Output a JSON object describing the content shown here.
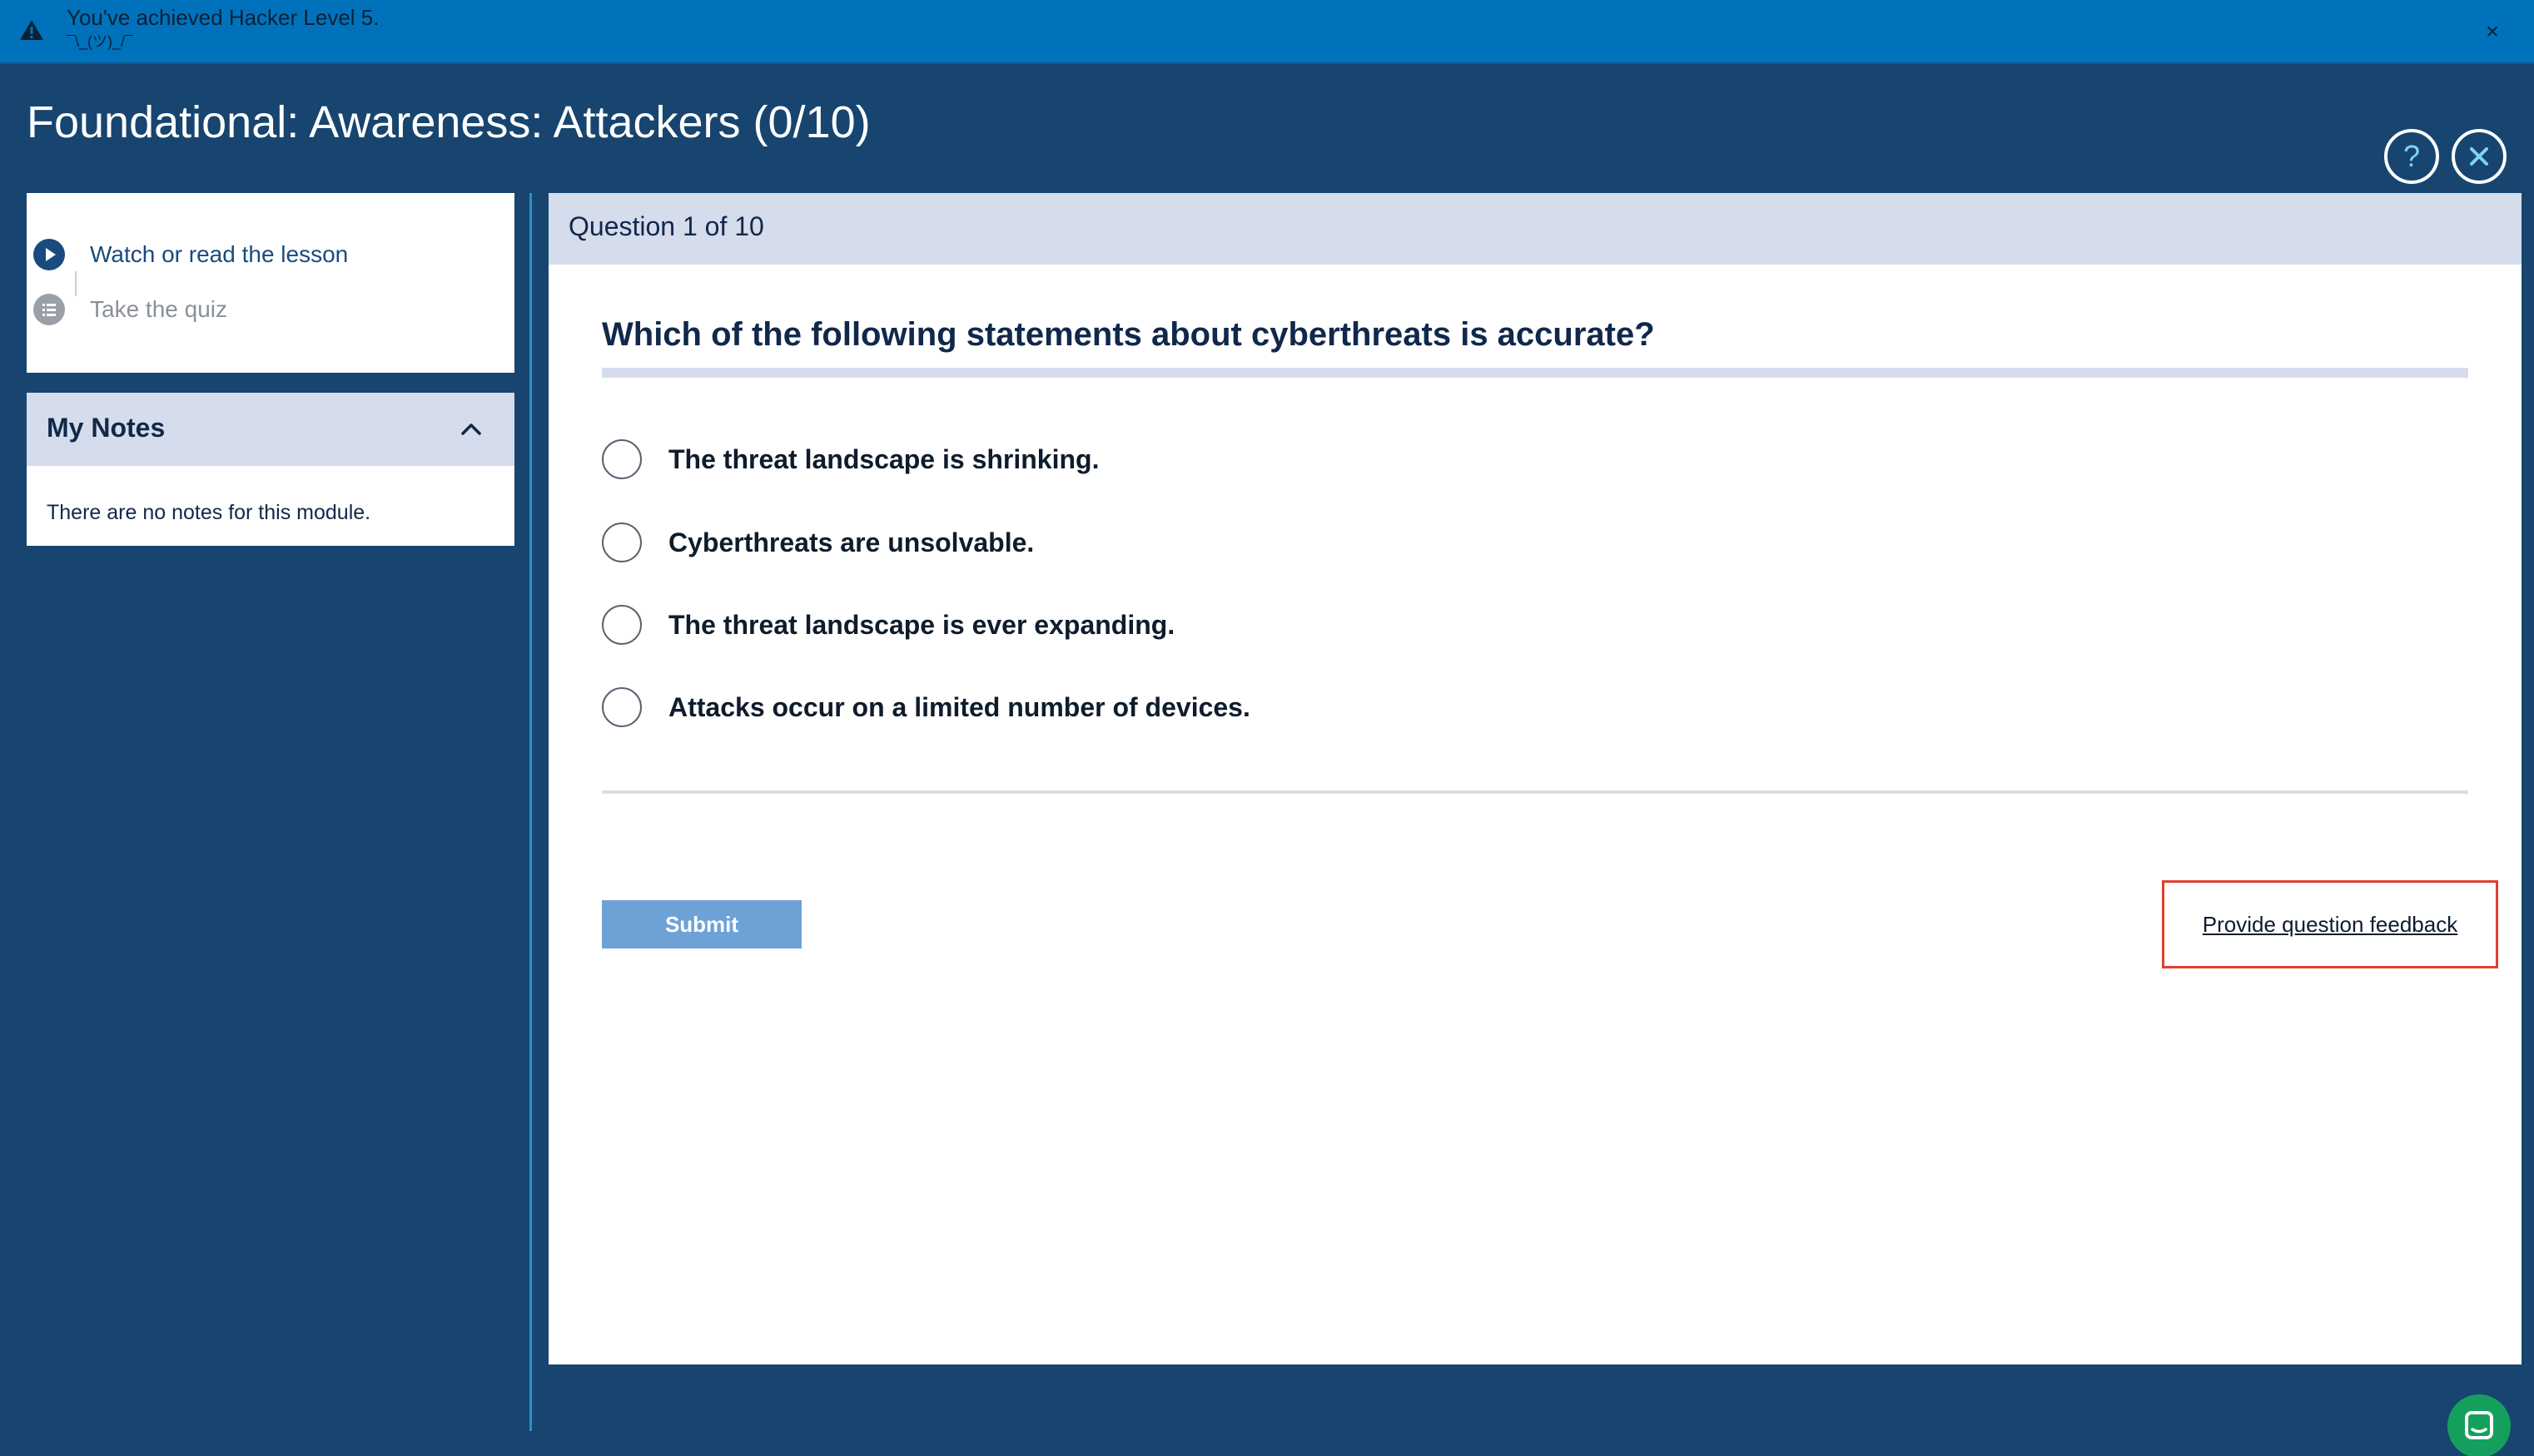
{
  "banner": {
    "message": "You've achieved Hacker Level 5.",
    "sub": "¯\\_(ツ)_/¯"
  },
  "page": {
    "title": "Foundational: Awareness: Attackers (0/10)"
  },
  "steps": [
    {
      "label": "Watch or read the lesson",
      "state": "active"
    },
    {
      "label": "Take the quiz",
      "state": "inactive"
    }
  ],
  "notes": {
    "title": "My Notes",
    "empty_text": "There are no notes for this module."
  },
  "question": {
    "counter": "Question 1 of 10",
    "text": "Which of the following statements about cyberthreats is accurate?",
    "options": [
      "The threat landscape is shrinking.",
      "Cyberthreats are unsolvable.",
      "The threat landscape is ever expanding.",
      "Attacks occur on a limited number of devices."
    ],
    "submit_label": "Submit",
    "feedback_label": "Provide question feedback"
  },
  "colors": {
    "background": "#17456f",
    "banner": "#0072bb",
    "submit": "#6ea2d6",
    "header_band": "#d5dceb",
    "chat": "#14a05c",
    "highlight_box": "#e0402f"
  },
  "icons": {
    "banner": "warning-icon",
    "banner_close": "close-icon",
    "help": "question-mark-icon",
    "close": "close-icon",
    "step_active": "play-icon",
    "step_inactive": "list-icon",
    "notes_toggle": "chevron-up-icon",
    "chat": "chat-icon"
  }
}
